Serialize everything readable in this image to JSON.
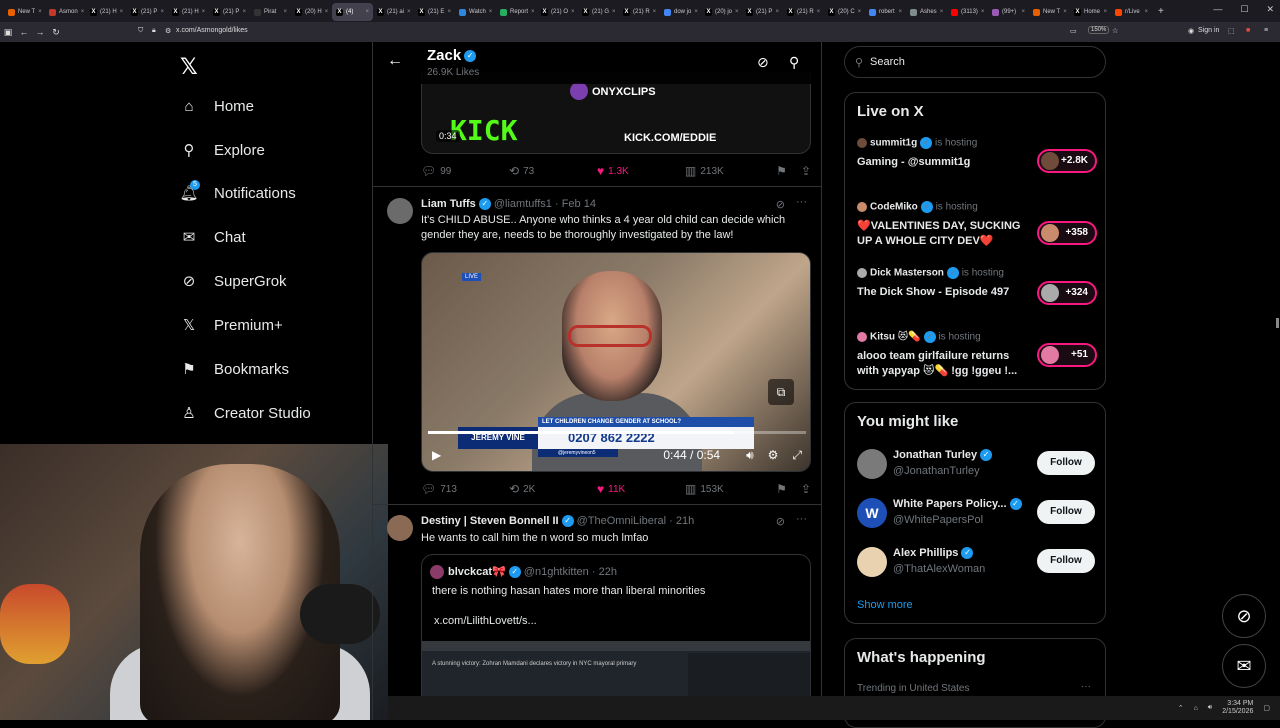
{
  "browser": {
    "tabs": [
      {
        "label": "New T",
        "icon": "firefox-icon",
        "color": "#e66000"
      },
      {
        "label": "Asmon",
        "icon": "tab-icon",
        "color": "#c0392b"
      },
      {
        "label": "(21) H",
        "icon": "x-icon",
        "color": "#000000"
      },
      {
        "label": "(21) P",
        "icon": "x-icon",
        "color": "#000000"
      },
      {
        "label": "(21) H",
        "icon": "x-icon",
        "color": "#000000"
      },
      {
        "label": "(21) P",
        "icon": "x-icon",
        "color": "#000000"
      },
      {
        "label": "Pirat",
        "icon": "tab-icon",
        "color": "#333333"
      },
      {
        "label": "(20) H",
        "icon": "x-icon",
        "color": "#000000"
      },
      {
        "label": "(4)",
        "icon": "x-icon",
        "color": "#000000",
        "active": true
      },
      {
        "label": "(21) ai",
        "icon": "x-icon",
        "color": "#000000"
      },
      {
        "label": "(21) E",
        "icon": "x-icon",
        "color": "#000000"
      },
      {
        "label": "Watch",
        "icon": "tab-icon",
        "color": "#2e86de"
      },
      {
        "label": "Report",
        "icon": "tab-icon",
        "color": "#27ae60"
      },
      {
        "label": "(21) O",
        "icon": "x-icon",
        "color": "#000000"
      },
      {
        "label": "(21) G",
        "icon": "x-icon",
        "color": "#000000"
      },
      {
        "label": "(21) R",
        "icon": "x-icon",
        "color": "#000000"
      },
      {
        "label": "dow jo",
        "icon": "tab-icon",
        "color": "#4285f4"
      },
      {
        "label": "(20) jo",
        "icon": "x-icon",
        "color": "#000000"
      },
      {
        "label": "(21) P",
        "icon": "x-icon",
        "color": "#000000"
      },
      {
        "label": "(21) R",
        "icon": "x-icon",
        "color": "#000000"
      },
      {
        "label": "(20) C",
        "icon": "x-icon",
        "color": "#000000"
      },
      {
        "label": "robert",
        "icon": "tab-icon",
        "color": "#4285f4"
      },
      {
        "label": "Ashes",
        "icon": "tab-icon",
        "color": "#7f8c8d"
      },
      {
        "label": "(3113)",
        "icon": "youtube-icon",
        "color": "#ff0000"
      },
      {
        "label": "(99+)",
        "icon": "tab-icon",
        "color": "#9b59b6"
      },
      {
        "label": "New T",
        "icon": "firefox-icon",
        "color": "#e66000"
      },
      {
        "label": "Home",
        "icon": "x-icon",
        "color": "#000000"
      },
      {
        "label": "r/Live",
        "icon": "reddit-icon",
        "color": "#ff4500"
      }
    ],
    "url": "x.com/Asmongold/likes",
    "zoom": "150%",
    "signin": "Sign in"
  },
  "nav": {
    "items": [
      {
        "label": "Home",
        "icon": "home-icon",
        "glyph": "⌂"
      },
      {
        "label": "Explore",
        "icon": "search-icon",
        "glyph": "⚲"
      },
      {
        "label": "Notifications",
        "icon": "bell-icon",
        "glyph": "🔔︎"
      },
      {
        "label": "Chat",
        "icon": "mail-icon",
        "glyph": "✉"
      },
      {
        "label": "SuperGrok",
        "icon": "grok-icon",
        "glyph": "⊘"
      },
      {
        "label": "Premium+",
        "icon": "x-premium-icon",
        "glyph": "𝕏"
      },
      {
        "label": "Bookmarks",
        "icon": "bookmark-icon",
        "glyph": "⚑"
      },
      {
        "label": "Creator Studio",
        "icon": "creator-studio-icon",
        "glyph": "♙"
      }
    ],
    "notification_badge": "5"
  },
  "profile": {
    "name": "Zack",
    "likes": "26.9K Likes"
  },
  "tweets": [
    {
      "clip": {
        "brand": "ONYXCLIPS",
        "kick": "KICK",
        "kick_url": "KICK.COM/EDDIE",
        "timestamp": "0:34"
      },
      "replies": "99",
      "reposts": "73",
      "likes": "1.3K",
      "views": "213K"
    },
    {
      "name": "Liam Tuffs",
      "handle": "@liamtuffs1",
      "date": "· Feb 14",
      "text": "It's CHILD ABUSE.. Anyone who thinks a 4 year old child can decide which gender they are, needs to be thoroughly investigated by the law!",
      "video": {
        "live": "LIVE",
        "banner": "LET CHILDREN CHANGE GENDER AT SCHOOL?",
        "phone": "0207 862 2222",
        "show": "JEREMY VINE",
        "tag": "@jeremyvineon5",
        "time": "0:44 / 0:54",
        "progress": 0.81
      },
      "replies": "713",
      "reposts": "2K",
      "likes": "11K",
      "views": "153K"
    },
    {
      "name": "Destiny | Steven Bonnell II",
      "handle": "@TheOmniLiberal",
      "date": "· 21h",
      "text": "He wants to call him the n word so much lmfao",
      "quote": {
        "name": "blvckcat🎀",
        "handle": "@n1ghtkitten",
        "date": "· 22h",
        "text": "there is nothing hasan hates more than liberal minorities",
        "link": "x.com/LilithLovett/s...",
        "image_caption": "A stunning victory: Zohran Mamdani declares victory in NYC mayoral primary"
      }
    }
  ],
  "sidebar": {
    "search_placeholder": "Search",
    "live_title": "Live on X",
    "live": [
      {
        "host": "summit1g",
        "status": "is hosting",
        "title": "Gaming - @summit1g",
        "count": "+2.8K"
      },
      {
        "host": "CodeMiko",
        "status": "is hosting",
        "title": "❤️VALENTINES DAY, SUCKING UP A WHOLE CITY DEV❤️",
        "count": "+358"
      },
      {
        "host": "Dick Masterson",
        "status": "is hosting",
        "title": "The Dick Show - Episode 497",
        "count": "+324"
      },
      {
        "host": "Kitsu 😻💊",
        "status": "is hosting",
        "title": "alooo team girlfailure returns with yapyap 😻💊 !gg !ggeu !...",
        "count": "+51"
      }
    ],
    "follow_title": "You might like",
    "follow": [
      {
        "name": "Jonathan Turley",
        "handle": "@JonathanTurley",
        "button": "Follow"
      },
      {
        "name": "White Papers Policy...",
        "handle": "@WhitePapersPol",
        "button": "Follow",
        "avatar_letter": "W"
      },
      {
        "name": "Alex Phillips",
        "handle": "@ThatAlexWoman",
        "button": "Follow"
      }
    ],
    "show_more": "Show more",
    "happening_title": "What's happening",
    "trending": "Trending in United States",
    "trend_more": "···"
  },
  "taskbar": {
    "time": "3:34 PM",
    "date": "2/15/2026"
  }
}
